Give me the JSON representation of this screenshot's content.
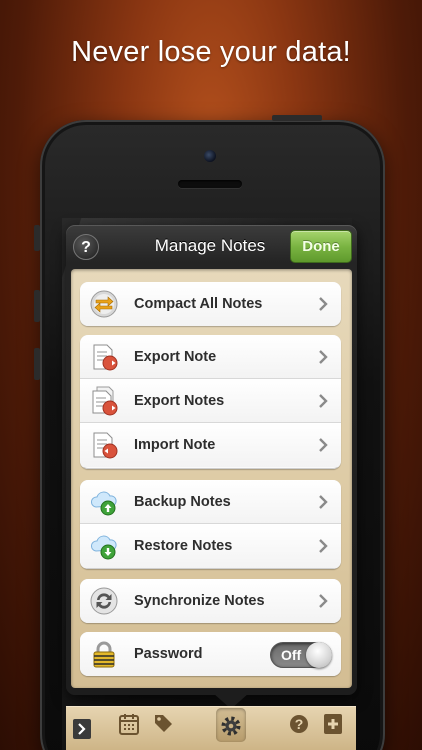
{
  "headline": "Never lose your data!",
  "navbar": {
    "title": "Manage Notes",
    "help_label": "?",
    "done_label": "Done"
  },
  "groups": [
    {
      "items": [
        {
          "label": "Compact All Notes",
          "icon": "compact-arrows-icon"
        }
      ]
    },
    {
      "items": [
        {
          "label": "Export Note",
          "icon": "export-document-icon"
        },
        {
          "label": "Export Notes",
          "icon": "export-documents-icon"
        },
        {
          "label": "Import Note",
          "icon": "import-document-icon"
        }
      ]
    },
    {
      "items": [
        {
          "label": "Backup Notes",
          "icon": "cloud-upload-icon"
        },
        {
          "label": "Restore Notes",
          "icon": "cloud-download-icon"
        }
      ]
    },
    {
      "items": [
        {
          "label": "Synchronize Notes",
          "icon": "sync-icon"
        }
      ]
    },
    {
      "items": [
        {
          "label": "Password",
          "icon": "padlock-icon",
          "toggle": "Off"
        }
      ]
    }
  ],
  "toolbar": {
    "icons": [
      "sidebar-toggle-icon",
      "calendar-icon",
      "tag-icon",
      "gear-icon",
      "help-icon",
      "add-note-icon"
    ],
    "active": "gear-icon"
  },
  "colors": {
    "accent_green": "#7ab442",
    "export_red": "#d9533c",
    "backup_green": "#3fa33a",
    "parchment": "#dcc9a2"
  }
}
